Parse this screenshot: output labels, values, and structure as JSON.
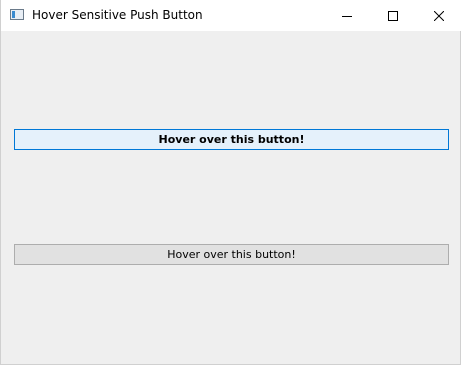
{
  "window": {
    "title": "Hover Sensitive Push Button",
    "controls": {
      "minimize": "minimize-icon",
      "maximize": "maximize-icon",
      "close": "close-icon"
    }
  },
  "buttons": [
    {
      "label": "Hover over this button!",
      "state": "hovered"
    },
    {
      "label": "Hover over this button!",
      "state": "normal"
    }
  ],
  "colors": {
    "hover_bg": "#e5f1fb",
    "hover_border": "#0078d7",
    "normal_bg": "#e1e1e1",
    "normal_border": "#adadad",
    "window_bg": "#efefef"
  }
}
